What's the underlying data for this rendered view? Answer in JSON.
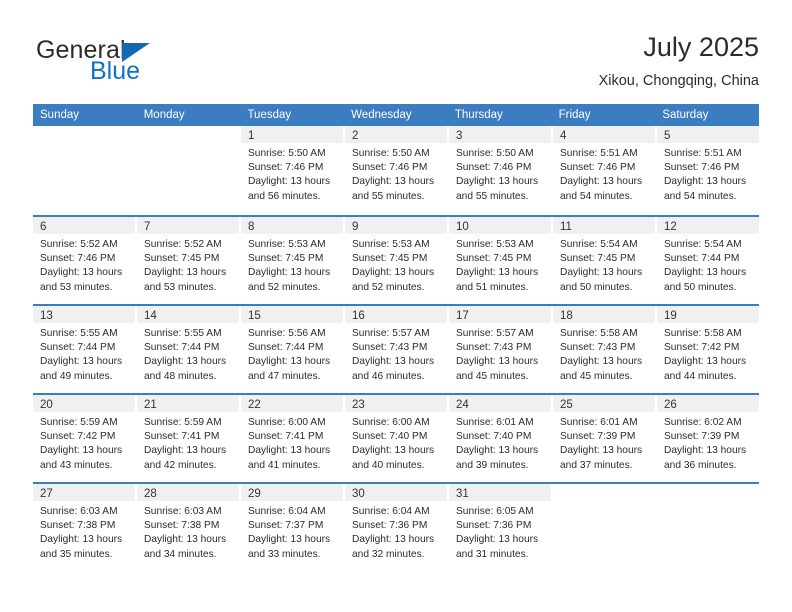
{
  "brand": {
    "word_general": "General",
    "word_blue": "Blue",
    "triangle_color": "#1567b2",
    "blue_color": "#1172c4"
  },
  "header": {
    "title": "July 2025",
    "subtitle": "Xikou, Chongqing, China"
  },
  "theme": {
    "header_blue": "#3b7dc0",
    "date_band_gray": "#f0f0f0",
    "text_color": "#2c2c2c"
  },
  "weekdays": [
    "Sunday",
    "Monday",
    "Tuesday",
    "Wednesday",
    "Thursday",
    "Friday",
    "Saturday"
  ],
  "weeks": [
    [
      {
        "day": "",
        "lines": []
      },
      {
        "day": "",
        "lines": []
      },
      {
        "day": "1",
        "lines": [
          "Sunrise: 5:50 AM",
          "Sunset: 7:46 PM",
          "Daylight: 13 hours",
          "and 56 minutes."
        ]
      },
      {
        "day": "2",
        "lines": [
          "Sunrise: 5:50 AM",
          "Sunset: 7:46 PM",
          "Daylight: 13 hours",
          "and 55 minutes."
        ]
      },
      {
        "day": "3",
        "lines": [
          "Sunrise: 5:50 AM",
          "Sunset: 7:46 PM",
          "Daylight: 13 hours",
          "and 55 minutes."
        ]
      },
      {
        "day": "4",
        "lines": [
          "Sunrise: 5:51 AM",
          "Sunset: 7:46 PM",
          "Daylight: 13 hours",
          "and 54 minutes."
        ]
      },
      {
        "day": "5",
        "lines": [
          "Sunrise: 5:51 AM",
          "Sunset: 7:46 PM",
          "Daylight: 13 hours",
          "and 54 minutes."
        ]
      }
    ],
    [
      {
        "day": "6",
        "lines": [
          "Sunrise: 5:52 AM",
          "Sunset: 7:46 PM",
          "Daylight: 13 hours",
          "and 53 minutes."
        ]
      },
      {
        "day": "7",
        "lines": [
          "Sunrise: 5:52 AM",
          "Sunset: 7:45 PM",
          "Daylight: 13 hours",
          "and 53 minutes."
        ]
      },
      {
        "day": "8",
        "lines": [
          "Sunrise: 5:53 AM",
          "Sunset: 7:45 PM",
          "Daylight: 13 hours",
          "and 52 minutes."
        ]
      },
      {
        "day": "9",
        "lines": [
          "Sunrise: 5:53 AM",
          "Sunset: 7:45 PM",
          "Daylight: 13 hours",
          "and 52 minutes."
        ]
      },
      {
        "day": "10",
        "lines": [
          "Sunrise: 5:53 AM",
          "Sunset: 7:45 PM",
          "Daylight: 13 hours",
          "and 51 minutes."
        ]
      },
      {
        "day": "11",
        "lines": [
          "Sunrise: 5:54 AM",
          "Sunset: 7:45 PM",
          "Daylight: 13 hours",
          "and 50 minutes."
        ]
      },
      {
        "day": "12",
        "lines": [
          "Sunrise: 5:54 AM",
          "Sunset: 7:44 PM",
          "Daylight: 13 hours",
          "and 50 minutes."
        ]
      }
    ],
    [
      {
        "day": "13",
        "lines": [
          "Sunrise: 5:55 AM",
          "Sunset: 7:44 PM",
          "Daylight: 13 hours",
          "and 49 minutes."
        ]
      },
      {
        "day": "14",
        "lines": [
          "Sunrise: 5:55 AM",
          "Sunset: 7:44 PM",
          "Daylight: 13 hours",
          "and 48 minutes."
        ]
      },
      {
        "day": "15",
        "lines": [
          "Sunrise: 5:56 AM",
          "Sunset: 7:44 PM",
          "Daylight: 13 hours",
          "and 47 minutes."
        ]
      },
      {
        "day": "16",
        "lines": [
          "Sunrise: 5:57 AM",
          "Sunset: 7:43 PM",
          "Daylight: 13 hours",
          "and 46 minutes."
        ]
      },
      {
        "day": "17",
        "lines": [
          "Sunrise: 5:57 AM",
          "Sunset: 7:43 PM",
          "Daylight: 13 hours",
          "and 45 minutes."
        ]
      },
      {
        "day": "18",
        "lines": [
          "Sunrise: 5:58 AM",
          "Sunset: 7:43 PM",
          "Daylight: 13 hours",
          "and 45 minutes."
        ]
      },
      {
        "day": "19",
        "lines": [
          "Sunrise: 5:58 AM",
          "Sunset: 7:42 PM",
          "Daylight: 13 hours",
          "and 44 minutes."
        ]
      }
    ],
    [
      {
        "day": "20",
        "lines": [
          "Sunrise: 5:59 AM",
          "Sunset: 7:42 PM",
          "Daylight: 13 hours",
          "and 43 minutes."
        ]
      },
      {
        "day": "21",
        "lines": [
          "Sunrise: 5:59 AM",
          "Sunset: 7:41 PM",
          "Daylight: 13 hours",
          "and 42 minutes."
        ]
      },
      {
        "day": "22",
        "lines": [
          "Sunrise: 6:00 AM",
          "Sunset: 7:41 PM",
          "Daylight: 13 hours",
          "and 41 minutes."
        ]
      },
      {
        "day": "23",
        "lines": [
          "Sunrise: 6:00 AM",
          "Sunset: 7:40 PM",
          "Daylight: 13 hours",
          "and 40 minutes."
        ]
      },
      {
        "day": "24",
        "lines": [
          "Sunrise: 6:01 AM",
          "Sunset: 7:40 PM",
          "Daylight: 13 hours",
          "and 39 minutes."
        ]
      },
      {
        "day": "25",
        "lines": [
          "Sunrise: 6:01 AM",
          "Sunset: 7:39 PM",
          "Daylight: 13 hours",
          "and 37 minutes."
        ]
      },
      {
        "day": "26",
        "lines": [
          "Sunrise: 6:02 AM",
          "Sunset: 7:39 PM",
          "Daylight: 13 hours",
          "and 36 minutes."
        ]
      }
    ],
    [
      {
        "day": "27",
        "lines": [
          "Sunrise: 6:03 AM",
          "Sunset: 7:38 PM",
          "Daylight: 13 hours",
          "and 35 minutes."
        ]
      },
      {
        "day": "28",
        "lines": [
          "Sunrise: 6:03 AM",
          "Sunset: 7:38 PM",
          "Daylight: 13 hours",
          "and 34 minutes."
        ]
      },
      {
        "day": "29",
        "lines": [
          "Sunrise: 6:04 AM",
          "Sunset: 7:37 PM",
          "Daylight: 13 hours",
          "and 33 minutes."
        ]
      },
      {
        "day": "30",
        "lines": [
          "Sunrise: 6:04 AM",
          "Sunset: 7:36 PM",
          "Daylight: 13 hours",
          "and 32 minutes."
        ]
      },
      {
        "day": "31",
        "lines": [
          "Sunrise: 6:05 AM",
          "Sunset: 7:36 PM",
          "Daylight: 13 hours",
          "and 31 minutes."
        ]
      },
      {
        "day": "",
        "lines": []
      },
      {
        "day": "",
        "lines": []
      }
    ]
  ]
}
